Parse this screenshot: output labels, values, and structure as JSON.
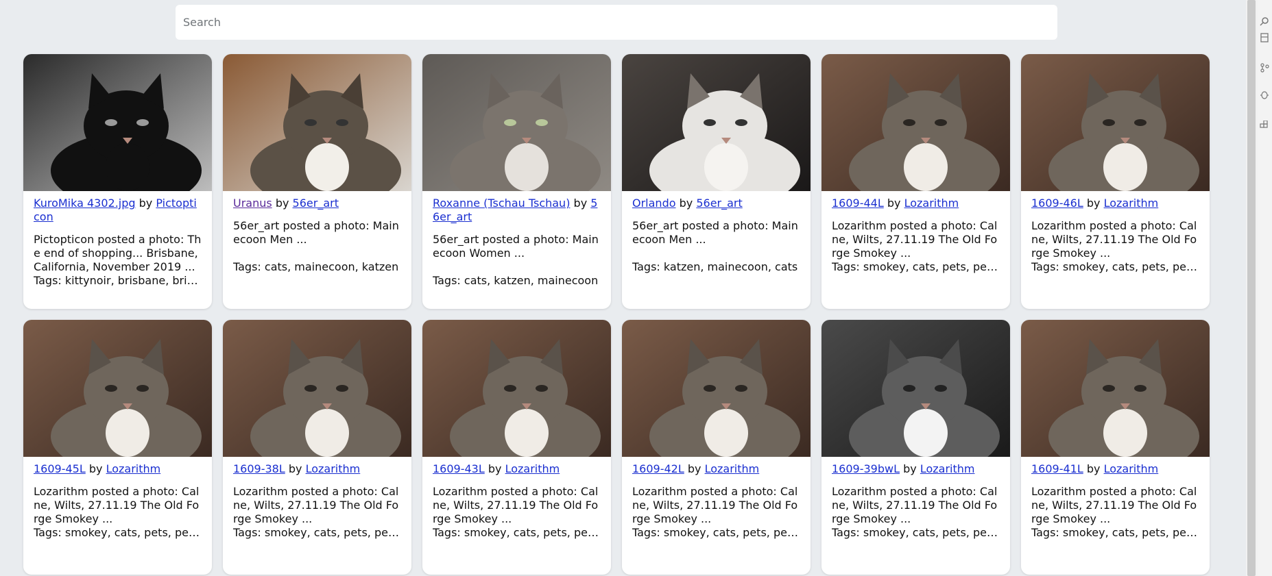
{
  "search": {
    "placeholder": "Search",
    "value": ""
  },
  "cards": [
    {
      "title": "KuroMika 4302.jpg",
      "by": "by",
      "author": "Pictopticon",
      "title_visited": false,
      "desc": "Pictopticon posted a photo: The end of shopping... Brisbane, California, November 2019 ...",
      "tags": "Tags: kittynoir, brisbane, brisbane",
      "image": "black-cat-bw-photo"
    },
    {
      "title": "Uranus",
      "by": "by",
      "author": "56er_art",
      "title_visited": true,
      "desc": "56er_art posted a photo: Mainecoon Men ...",
      "tags": "Tags: cats, mainecoon, katzen",
      "image": "mainecoon-lying-photo"
    },
    {
      "title": "Roxanne (Tschau Tschau)",
      "by": "by",
      "author": "56er_art",
      "title_visited": false,
      "desc": "56er_art posted a photo: Mainecoon Women ...",
      "tags": "Tags: cats, katzen, mainecoon",
      "image": "tabby-closeup-photo"
    },
    {
      "title": "Orlando",
      "by": "by",
      "author": "56er_art",
      "title_visited": false,
      "desc": "56er_art posted a photo: Mainecoon Men ...",
      "tags": "Tags: katzen, mainecoon, cats",
      "image": "fluffy-cat-dark-photo"
    },
    {
      "title": "1609-44L",
      "by": "by",
      "author": "Lozarithm",
      "title_visited": false,
      "desc": "Lozarithm posted a photo: Calne, Wilts, 27.11.19 The Old Forge Smokey ...",
      "tags": "Tags: smokey, cats, pets, pentax",
      "image": "smokey-cat-photo"
    },
    {
      "title": "1609-46L",
      "by": "by",
      "author": "Lozarithm",
      "title_visited": false,
      "desc": "Lozarithm posted a photo: Calne, Wilts, 27.11.19 The Old Forge Smokey ...",
      "tags": "Tags: smokey, cats, pets, pentax",
      "image": "smokey-cat-photo"
    },
    {
      "title": "1609-45L",
      "by": "by",
      "author": "Lozarithm",
      "title_visited": false,
      "desc": "Lozarithm posted a photo: Calne, Wilts, 27.11.19 The Old Forge Smokey ...",
      "tags": "Tags: smokey, cats, pets, pentax",
      "image": "smokey-cat-photo"
    },
    {
      "title": "1609-38L",
      "by": "by",
      "author": "Lozarithm",
      "title_visited": false,
      "desc": "Lozarithm posted a photo: Calne, Wilts, 27.11.19 The Old Forge Smokey ...",
      "tags": "Tags: smokey, cats, pets, pentax",
      "image": "smokey-cat-photo"
    },
    {
      "title": "1609-43L",
      "by": "by",
      "author": "Lozarithm",
      "title_visited": false,
      "desc": "Lozarithm posted a photo: Calne, Wilts, 27.11.19 The Old Forge Smokey ...",
      "tags": "Tags: smokey, cats, pets, pentax",
      "image": "smokey-cat-photo"
    },
    {
      "title": "1609-42L",
      "by": "by",
      "author": "Lozarithm",
      "title_visited": false,
      "desc": "Lozarithm posted a photo: Calne, Wilts, 27.11.19 The Old Forge Smokey ...",
      "tags": "Tags: smokey, cats, pets, pentax",
      "image": "smokey-cat-photo"
    },
    {
      "title": "1609-39bwL",
      "by": "by",
      "author": "Lozarithm",
      "title_visited": false,
      "desc": "Lozarithm posted a photo: Calne, Wilts, 27.11.19 The Old Forge Smokey ...",
      "tags": "Tags: smokey, cats, pets, pentax",
      "image": "smokey-cat-bw-photo"
    },
    {
      "title": "1609-41L",
      "by": "by",
      "author": "Lozarithm",
      "title_visited": false,
      "desc": "Lozarithm posted a photo: Calne, Wilts, 27.11.19 The Old Forge Smokey ...",
      "tags": "Tags: smokey, cats, pets, pentax",
      "image": "smokey-cat-photo"
    }
  ],
  "colors": {
    "page_bg": "#e9ecef",
    "link": "#1a2fd0",
    "link_visited": "#5a2a9a",
    "card_bg": "#ffffff"
  },
  "side_icons": [
    "search-icon",
    "files-icon",
    "source-control-icon",
    "debug-icon",
    "extensions-icon"
  ]
}
